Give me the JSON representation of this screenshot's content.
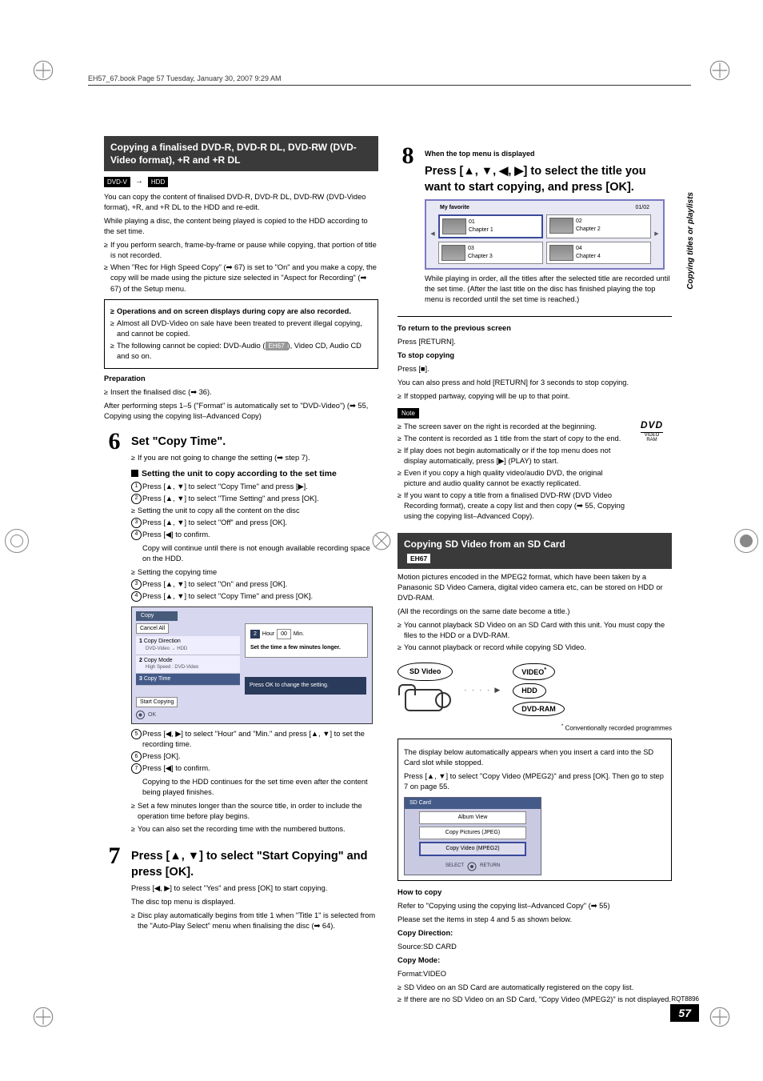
{
  "header_bar": "EH57_67.book  Page 57  Tuesday, January 30, 2007  9:29 AM",
  "side_tab": "Copying titles or playlists",
  "page_num": "57",
  "rqt": "RQT8896",
  "left": {
    "section_head": "Copying a finalised DVD-R, DVD-R DL, DVD-RW (DVD-Video format), +R and +R DL",
    "media_from": "DVD-V",
    "media_to": "HDD",
    "intro1": "You can copy the content of finalised DVD-R, DVD-R DL, DVD-RW (DVD-Video format), +R, and +R DL to the HDD and re-edit.",
    "intro2": "While playing a disc, the content being played is copied to the HDD according to the set time.",
    "b1": "If you perform search, frame-by-frame or pause while copying, that portion of title is not recorded.",
    "b2": "When \"Rec for High Speed Copy\" (➡ 67) is set to \"On\" and you make a copy, the copy will be made using the picture size selected in \"Aspect for Recording\" (➡ 67) of the Setup menu.",
    "box_b1": "Operations and on screen displays during copy are also recorded.",
    "box_b2": "Almost all DVD-Video on sale have been treated to prevent illegal copying, and cannot be copied.",
    "box_b3_pre": "The following cannot be copied: DVD-Audio (",
    "box_b3_chip": "EH67",
    "box_b3_post": "), Video CD, Audio CD and so on.",
    "prep_h": "Preparation",
    "prep_b": "Insert the finalised disc (➡ 36).",
    "after_steps": "After performing steps 1–5 (\"Format\" is automatically set to \"DVD-Video\") (➡ 55, Copying using the copying list–Advanced Copy)",
    "step6": {
      "title": "Set \"Copy Time\".",
      "b1": "If you are not going to change the setting (➡ step 7).",
      "subh": "Setting the unit to copy according to the set time",
      "n1": "Press [▲, ▼] to select \"Copy Time\" and press [▶].",
      "n2": "Press [▲, ▼] to select \"Time Setting\" and press [OK].",
      "grp1_t": "Setting the unit to copy all the content on the disc",
      "n3": "Press [▲, ▼] to select \"Off\" and press [OK].",
      "n4": "Press [◀] to confirm.",
      "n4_after": "Copy will continue until there is not enough available recording space on the HDD.",
      "grp2_t": "Setting the copying time",
      "n3b": "Press [▲, ▼] to select \"On\" and press [OK].",
      "n4b": "Press [▲, ▼] to select \"Copy Time\" and press [OK].",
      "ui": {
        "title": "Copy",
        "cancel_all": "Cancel All",
        "items": [
          "Copy Direction",
          "Copy Mode",
          "Copy Time"
        ],
        "cd_val": "DVD-Video → HDD",
        "cm_val": "High Speed : DVD-Video",
        "start": "Start Copying",
        "side_hour": "Hour",
        "side_min": "Min.",
        "side_hour_n": "2",
        "side_min_n": "00",
        "side_note": "Set the time a few minutes longer.",
        "foot": "Press OK to change the setting.",
        "ok": "OK"
      },
      "n5": "Press [◀, ▶] to select \"Hour\" and \"Min.\" and press [▲, ▼] to set the recording time.",
      "n6": "Press [OK].",
      "n7": "Press [◀] to confirm.",
      "n7_after": "Copying to the HDD continues for the set time even after the content being played finishes.",
      "tail_b1": "Set a few minutes longer than the source title, in order to include the operation time before play begins.",
      "tail_b2": "You can also set the recording time with the numbered buttons."
    },
    "step7": {
      "title": "Press [▲, ▼] to select \"Start Copying\" and press [OK].",
      "p1": "Press [◀, ▶] to select \"Yes\" and press [OK] to start copying.",
      "p2": "The disc top menu is displayed.",
      "b1": "Disc play automatically begins from title 1 when \"Title 1\" is selected from the \"Auto-Play Select\" menu when finalising the disc (➡ 64)."
    }
  },
  "right": {
    "step8": {
      "top_label": "When the top menu is displayed",
      "title": "Press [▲, ▼, ◀, ▶] to select the title you want to start copying, and press [OK].",
      "menu": {
        "title": "My favorite",
        "count": "01/02",
        "cells": [
          "01",
          "02",
          "03",
          "04"
        ],
        "chapters": [
          "Chapter 1",
          "Chapter 2",
          "Chapter 3",
          "Chapter 4"
        ]
      },
      "after": "While playing in order, all the titles after the selected title are recorded until the set time. (After the last title on the disc has finished playing the top menu is recorded until the set time is reached.)"
    },
    "return_h": "To return to the previous screen",
    "return_p": "Press [RETURN].",
    "stop_h": "To stop copying",
    "stop_p1": "Press [■].",
    "stop_p2": "You can also press and hold [RETURN] for 3 seconds to stop copying.",
    "stop_b": "If stopped partway, copying will be up to that point.",
    "note_label": "Note",
    "note_b1": "The screen saver on the right is recorded at the beginning.",
    "note_b2": "The content is recorded as 1 title from the start of copy to the end.",
    "note_b3": "If play does not begin automatically or if the top menu does not display automatically, press [▶] (PLAY) to start.",
    "note_b4": "Even if you copy a high quality video/audio DVD, the original picture and audio quality cannot be exactly replicated.",
    "note_b5": "If you want to copy a title from a finalised DVD-RW (DVD Video Recording format), create a copy list and then copy (➡ 55, Copying using the copying list–Advanced Copy).",
    "dvd_logo": "DVD",
    "dvd_sub": "VIDEO\nRAM",
    "section2_head": "Copying SD Video from an SD Card",
    "section2_chip": "EH67",
    "s2_p1": "Motion pictures encoded in the MPEG2 format, which have been taken by a Panasonic SD Video Camera, digital video camera etc, can be stored on HDD or DVD-RAM.",
    "s2_p2": "(All the recordings on the same date become a title.)",
    "s2_b1": "You cannot playback SD Video on an SD Card with this unit. You must copy the files to the HDD or a DVD-RAM.",
    "s2_b2": "You cannot playback or record while copying SD Video.",
    "diagram": {
      "sd": "SD Video",
      "video": "VIDEO",
      "hdd": "HDD",
      "ram": "DVD-RAM"
    },
    "asterisk_note": "Conventionally recorded programmes",
    "card_box_p1": "The display below automatically appears when you insert a card into the SD Card slot while stopped.",
    "card_box_p2": "Press [▲, ▼] to select \"Copy Video (MPEG2)\" and press [OK]. Then go to step 7 on page 55.",
    "sd_ui": {
      "title": "SD Card",
      "opts": [
        "Album View",
        "Copy Pictures (JPEG)",
        "Copy Video (MPEG2)"
      ],
      "select": "SELECT",
      "return": "RETURN"
    },
    "how_h": "How to copy",
    "how_p1": "Refer to \"Copying using the copying list–Advanced Copy\" (➡ 55)",
    "how_p2": "Please set the items in step 4 and 5 as shown below.",
    "cd_h": "Copy Direction:",
    "cd_v": "Source:SD CARD",
    "cm_h": "Copy Mode:",
    "cm_v": "Format:VIDEO",
    "tail_b1": "SD Video on an SD Card are automatically registered on the copy list.",
    "tail_b2": "If there are no SD Video on an SD Card, \"Copy Video (MPEG2)\" is not displayed."
  }
}
